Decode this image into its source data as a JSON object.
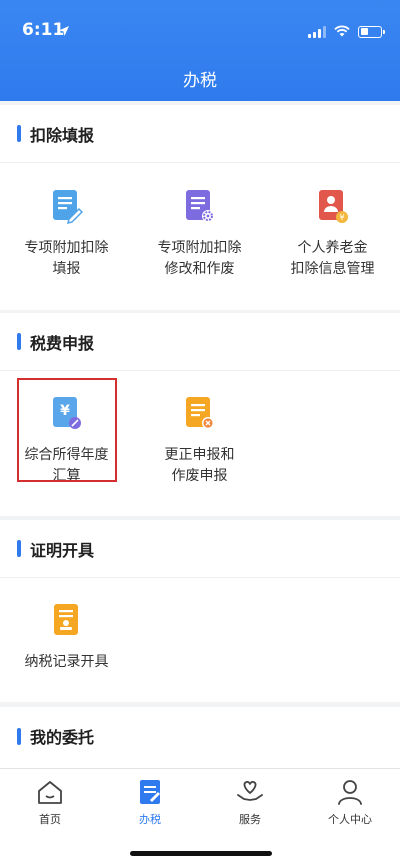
{
  "status": {
    "time": "6:11"
  },
  "nav": {
    "title": "办税"
  },
  "sections": [
    {
      "title": "扣除填报",
      "items": [
        {
          "label": "专项附加扣除\n填报",
          "icon": "form-edit-icon"
        },
        {
          "label": "专项附加扣除\n修改和作废",
          "icon": "form-settings-icon"
        },
        {
          "label": "个人养老金\n扣除信息管理",
          "icon": "pension-icon"
        }
      ]
    },
    {
      "title": "税费申报",
      "items": [
        {
          "label": "综合所得年度\n汇算",
          "icon": "yuan-form-icon"
        },
        {
          "label": "更正申报和\n作废申报",
          "icon": "form-cancel-icon"
        }
      ]
    },
    {
      "title": "证明开具",
      "items": [
        {
          "label": "纳税记录开具",
          "icon": "stamp-record-icon"
        }
      ]
    },
    {
      "title": "我的委托",
      "items": []
    }
  ],
  "tabbar": {
    "tabs": [
      {
        "label": "首页",
        "icon": "home-icon"
      },
      {
        "label": "办税",
        "icon": "tax-doc-icon"
      },
      {
        "label": "服务",
        "icon": "heart-hand-icon"
      },
      {
        "label": "个人中心",
        "icon": "user-icon"
      }
    ],
    "active": "办税"
  },
  "colors": {
    "brand": "#2f7bee",
    "highlight": "#d32f2f"
  }
}
